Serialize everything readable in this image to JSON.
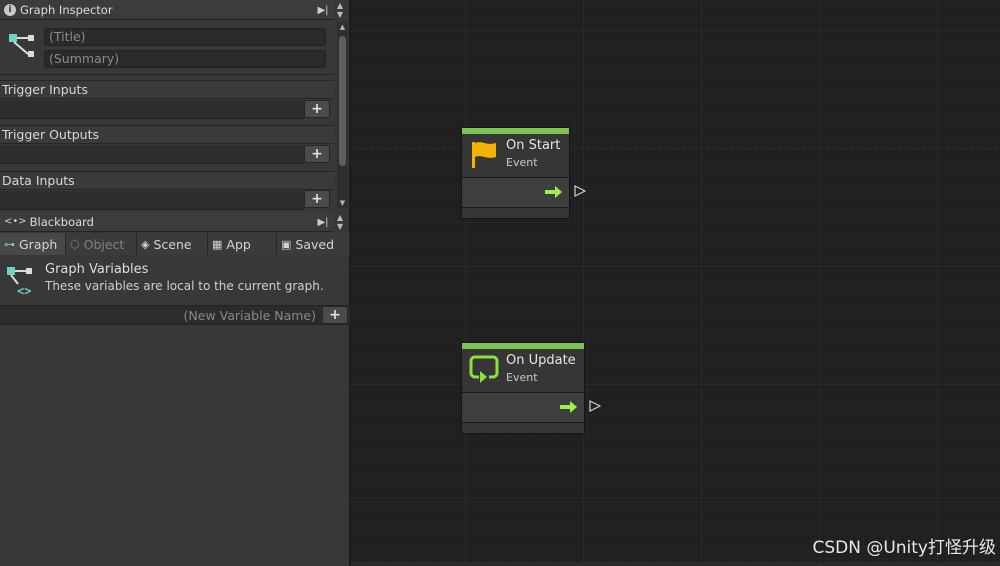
{
  "inspector": {
    "title": "Graph Inspector",
    "title_placeholder": "(Title)",
    "summary_placeholder": "(Summary)",
    "sections": [
      {
        "label": "Trigger Inputs"
      },
      {
        "label": "Trigger Outputs"
      },
      {
        "label": "Data Inputs"
      }
    ],
    "add_label": "+"
  },
  "blackboard": {
    "title": "Blackboard",
    "tabs": [
      {
        "label": "Graph",
        "icon": "graph-icon",
        "active": true
      },
      {
        "label": "Object",
        "icon": "cube-icon",
        "disabled": true
      },
      {
        "label": "Scene",
        "icon": "scene-icon"
      },
      {
        "label": "App",
        "icon": "app-icon"
      },
      {
        "label": "Saved",
        "icon": "save-icon"
      }
    ],
    "heading": "Graph Variables",
    "description": "These variables are local to the current graph.",
    "new_variable_placeholder": "(New Variable Name)",
    "add_label": "+"
  },
  "nodes": [
    {
      "title": "On Start",
      "subtitle": "Event",
      "icon": "flag-icon",
      "icon_color": "#f2b400"
    },
    {
      "title": "On Update",
      "subtitle": "Event",
      "icon": "loop-icon",
      "icon_color": "#8ee03a"
    }
  ],
  "colors": {
    "accent": "#7cc452",
    "flow_arrow": "#9ef04a"
  },
  "watermark": "CSDN @Unity打怪升级"
}
